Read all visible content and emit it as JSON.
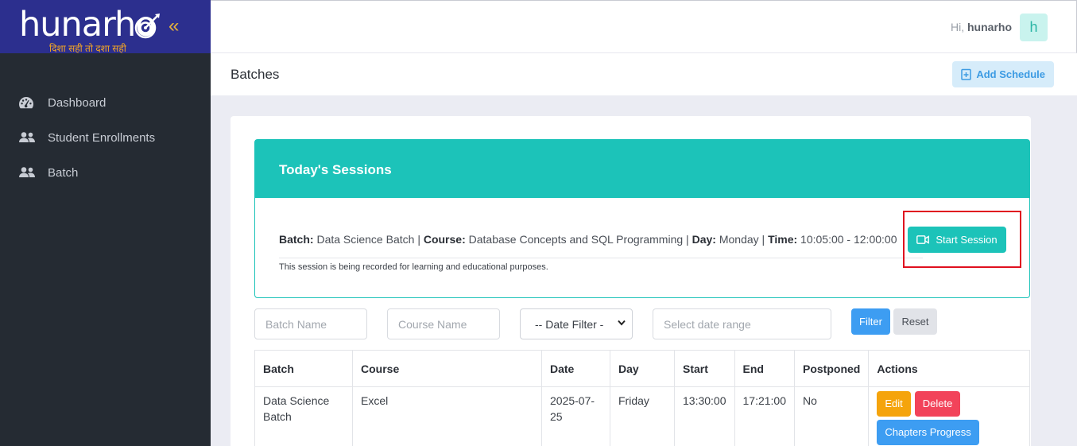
{
  "brand": {
    "logo": "hunarho",
    "tagline": "दिशा सही तो दशा सही",
    "collapse": "«"
  },
  "sidebar": {
    "items": [
      {
        "label": "Dashboard",
        "icon": "dashboard-icon"
      },
      {
        "label": "Student Enrollments",
        "icon": "users-icon"
      },
      {
        "label": "Batch",
        "icon": "users-icon"
      }
    ]
  },
  "topbar": {
    "greeting": "Hi,",
    "username": "hunarho",
    "avatar_letter": "h"
  },
  "page": {
    "title": "Batches",
    "add_schedule": "Add Schedule"
  },
  "sessions": {
    "title": "Today's Sessions",
    "batch_label": "Batch:",
    "batch": "Data Science Batch",
    "course_label": "Course:",
    "course": "Database Concepts and SQL Programming",
    "day_label": "Day:",
    "day": "Monday",
    "time_label": "Time:",
    "time": "10:05:00 - 12:00:00",
    "sep": "|",
    "note": "This session is being recorded for learning and educational purposes.",
    "start_button": "Start Session"
  },
  "filters": {
    "batch_placeholder": "Batch Name",
    "course_placeholder": "Course Name",
    "date_filter": "-- Date Filter -",
    "range_placeholder": "Select date range",
    "filter": "Filter",
    "reset": "Reset"
  },
  "table": {
    "headers": [
      "Batch",
      "Course",
      "Date",
      "Day",
      "Start",
      "End",
      "Postponed",
      "Actions"
    ],
    "rows": [
      {
        "batch": "Data Science Batch",
        "course": "Excel",
        "date": "2025-07-25",
        "day": "Friday",
        "start": "13:30:00",
        "end": "17:21:00",
        "postponed": "No",
        "actions": {
          "edit": "Edit",
          "delete": "Delete",
          "progress": "Chapters Progress"
        }
      }
    ]
  },
  "colors": {
    "teal": "#1cc3b9",
    "sidebar": "#252b33",
    "brand": "#2c2f8e",
    "blue": "#3d9df2",
    "highlight": "#e0101f"
  }
}
